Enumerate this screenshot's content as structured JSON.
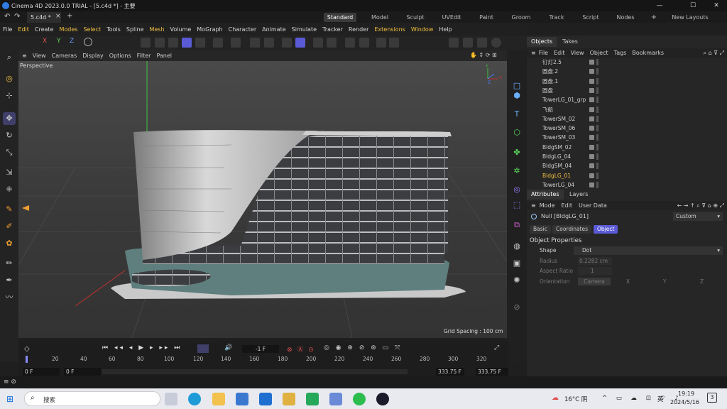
{
  "window": {
    "title": "Cinema 4D 2023.0.0 TRIAL - [5.c4d *] - 主要"
  },
  "tabs": {
    "doc_tab": "5.c4d *",
    "close": "×",
    "plus": "+"
  },
  "layouts": [
    "Standard",
    "Model",
    "Sculpt",
    "UVEdit",
    "Paint",
    "Groom",
    "Track",
    "Script",
    "Nodes"
  ],
  "layout_plus": "+",
  "new_layouts": "New Layouts",
  "menu": [
    "File",
    "Edit",
    "Create",
    "Modes",
    "Select",
    "Tools",
    "Spline",
    "Mesh",
    "Volume",
    "MoGraph",
    "Character",
    "Animate",
    "Simulate",
    "Tracker",
    "Render",
    "Extensions",
    "Window",
    "Help"
  ],
  "axis_buttons": [
    "X",
    "Y",
    "Z"
  ],
  "viewport": {
    "menu": [
      "View",
      "Cameras",
      "Display",
      "Options",
      "Filter",
      "Panel"
    ],
    "label": "Perspective",
    "grid_spacing": "Grid Spacing : 100 cm"
  },
  "object_manager": {
    "tabs": [
      "Objects",
      "Takes"
    ],
    "menu": [
      "File",
      "Edit",
      "View",
      "Object",
      "Tags",
      "Bookmarks"
    ],
    "objects": [
      "钉灯2.5",
      "圆盘.2",
      "圆盘.1",
      "圆盘",
      "TowerLG_01_grp",
      "飞船",
      "TowerSM_02",
      "TowerSM_06",
      "TowerSM_03",
      "BldgSM_02",
      "BldgLG_04",
      "BldgSM_04",
      "BldgLG_01",
      "TowerLG_04"
    ],
    "selected": "BldgLG_01"
  },
  "attributes": {
    "tabs": [
      "Attributes",
      "Layers"
    ],
    "menu": [
      "Mode",
      "Edit",
      "User Data"
    ],
    "object_name": "Null [BldgLG_01]",
    "preset": "Custom",
    "sub_tabs": [
      "Basic",
      "Coordinates",
      "Object"
    ],
    "active_sub_tab": "Object",
    "section": "Object Properties",
    "shape_label": "Shape",
    "shape_value": "Dot",
    "radius_label": "Radius",
    "radius_value": "0.2282 cm",
    "aspect_label": "Aspect Ratio",
    "aspect_value": "1",
    "orientation_label": "Orientation",
    "orientation_value": "Camera",
    "orient_axes": [
      "X",
      "Y",
      "Z"
    ]
  },
  "timeline": {
    "current_frame": "-1 F",
    "ruler": [
      "0",
      "20",
      "40",
      "60",
      "80",
      "100",
      "120",
      "140",
      "160",
      "180",
      "200",
      "220",
      "240",
      "260",
      "280",
      "300",
      "320"
    ],
    "start": "0 F",
    "start2": "0 F",
    "end": "333.75 F",
    "end2": "333.75 F"
  },
  "taskbar": {
    "search": "搜索",
    "weather": "16°C 阴",
    "lang": "英",
    "time": "19:19",
    "date": "2024/5/16",
    "notif": "3"
  },
  "colors": {
    "accent": "#5a5ad6",
    "highlight": "#f0c040",
    "viewport_bg": "#3e3e3e"
  }
}
